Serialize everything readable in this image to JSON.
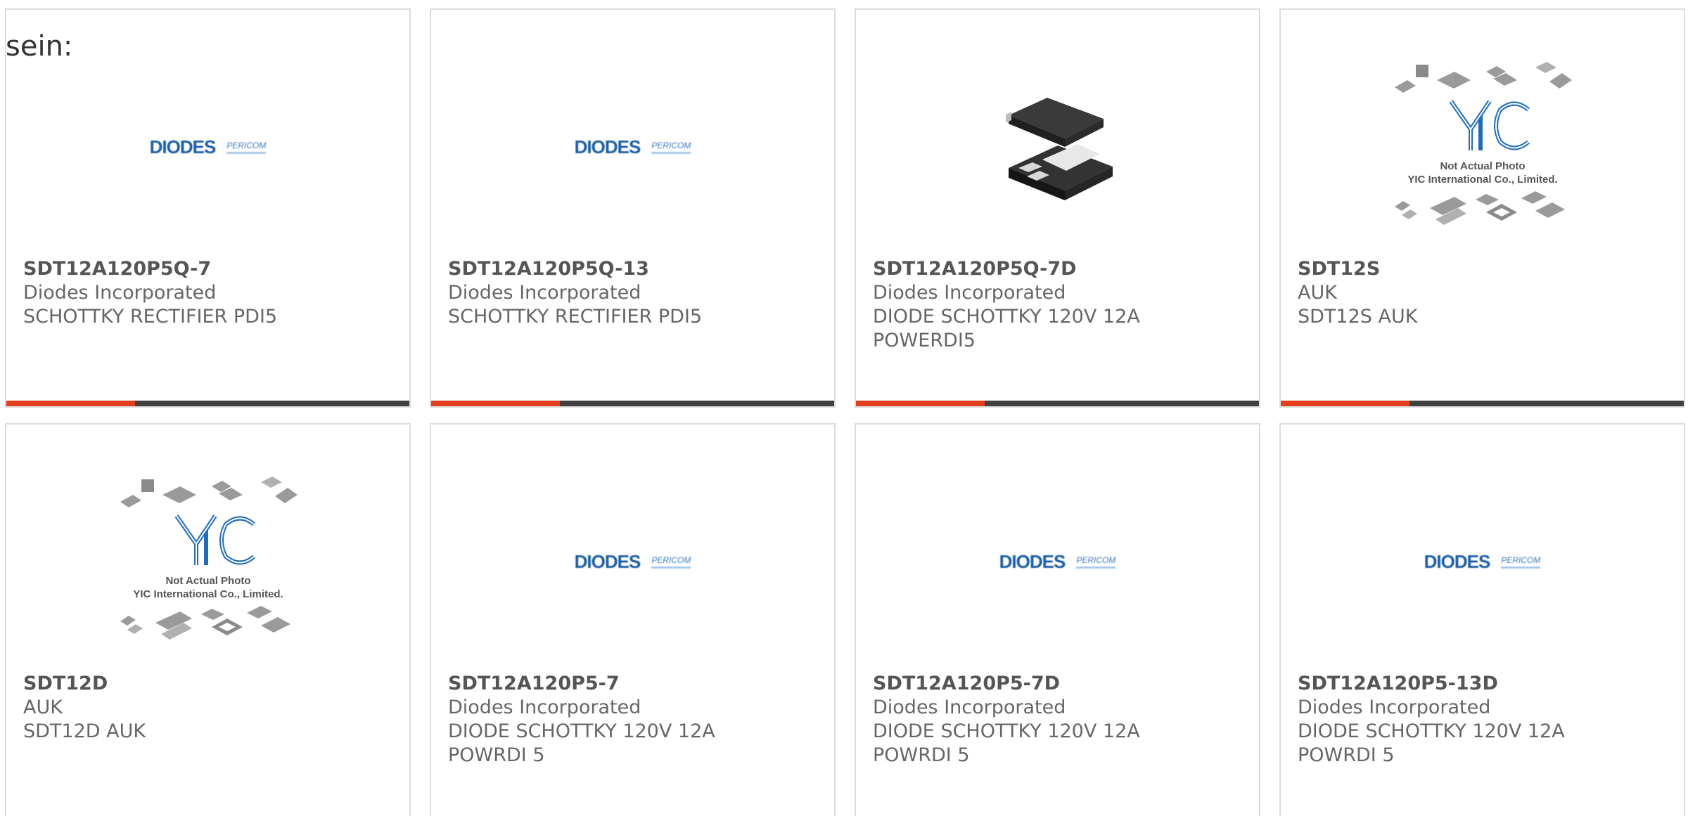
{
  "intro_text": "sein:",
  "colors": {
    "accent": "#e53e1c",
    "bar": "#404040",
    "border": "#dcdcdc",
    "text": "#666666"
  },
  "logo": {
    "diodes": "DIODES",
    "pericom": "PERICOM"
  },
  "yic_caption": {
    "line1": "Not Actual Photo",
    "line2": "YIC International Co., Limited."
  },
  "cards": [
    {
      "part": "SDT12A120P5Q-7",
      "maker": "Diodes Incorporated",
      "desc1": "SCHOTTKY RECTIFIER PDI5",
      "desc2": "",
      "image": "diodes-logo"
    },
    {
      "part": "SDT12A120P5Q-13",
      "maker": "Diodes Incorporated",
      "desc1": "SCHOTTKY RECTIFIER PDI5",
      "desc2": "",
      "image": "diodes-logo"
    },
    {
      "part": "SDT12A120P5Q-7D",
      "maker": "Diodes Incorporated",
      "desc1": "DIODE SCHOTTKY 120V 12A",
      "desc2": "POWERDI5",
      "image": "package-photo"
    },
    {
      "part": "SDT12S",
      "maker": "AUK",
      "desc1": "SDT12S AUK",
      "desc2": "",
      "image": "yic-placeholder"
    },
    {
      "part": "SDT12D",
      "maker": "AUK",
      "desc1": "SDT12D AUK",
      "desc2": "",
      "image": "yic-placeholder"
    },
    {
      "part": "SDT12A120P5-7",
      "maker": "Diodes Incorporated",
      "desc1": "DIODE SCHOTTKY 120V 12A",
      "desc2": "POWRDI 5",
      "image": "diodes-logo"
    },
    {
      "part": "SDT12A120P5-7D",
      "maker": "Diodes Incorporated",
      "desc1": "DIODE SCHOTTKY 120V 12A",
      "desc2": "POWRDI 5",
      "image": "diodes-logo"
    },
    {
      "part": "SDT12A120P5-13D",
      "maker": "Diodes Incorporated",
      "desc1": "DIODE SCHOTTKY 120V 12A",
      "desc2": "POWRDI 5",
      "image": "diodes-logo"
    }
  ]
}
